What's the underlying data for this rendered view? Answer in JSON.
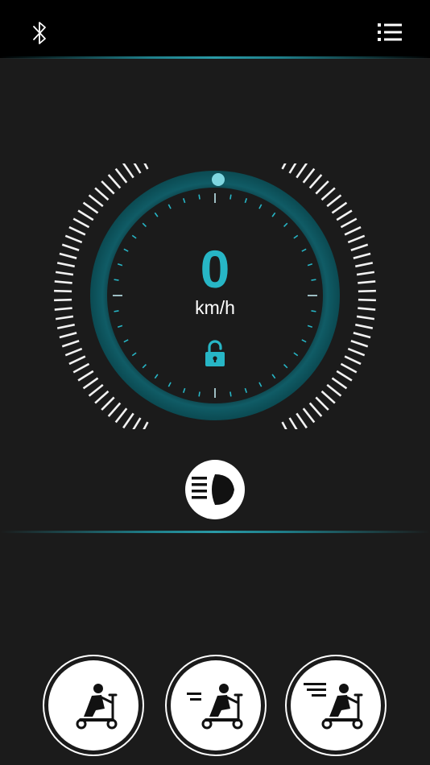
{
  "header": {
    "bluetooth_icon": "bluetooth-icon",
    "menu_icon": "menu-list-icon"
  },
  "speedometer": {
    "speed": "0",
    "unit": "km/h",
    "lock_icon": "unlocked-padlock-icon",
    "lock_state": "unlocked"
  },
  "headlight": {
    "icon": "headlight-icon"
  },
  "modes": [
    {
      "icon": "scooter-rider-slow-icon"
    },
    {
      "icon": "scooter-rider-medium-icon"
    },
    {
      "icon": "scooter-rider-fast-icon"
    }
  ],
  "colors": {
    "background": "#1b1b1b",
    "topbar": "#000000",
    "accent": "#27b6c6",
    "gauge_ring": "#0f5a63"
  }
}
